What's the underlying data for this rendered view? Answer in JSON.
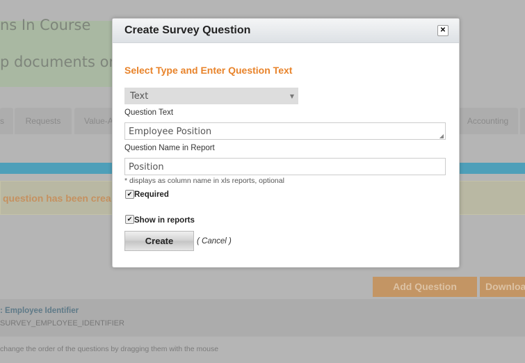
{
  "background": {
    "heading1": "ns In Course",
    "heading2": "p documents or",
    "tabs": [
      "s",
      "Requests",
      "Value-A",
      "Accounting"
    ],
    "message": "question has been crea",
    "add_question": "Add Question",
    "download": "Downloa",
    "item_title": ": Employee Identifier",
    "item_code": "SURVEY_EMPLOYEE_IDENTIFIER",
    "hint": "change the order of the questions by dragging them with the mouse"
  },
  "dialog": {
    "title": "Create Survey Question",
    "close": "✕",
    "section_title": "Select Type and Enter Question Text",
    "type_select": "Text",
    "question_text_label": "Question Text",
    "question_text_value": "Employee Position",
    "report_name_label": "Question Name in Report",
    "report_name_value": "Position",
    "report_name_hint": "* displays as column name in xls reports, optional",
    "required_label": "Required",
    "required_checked": true,
    "show_in_reports_label": "Show in reports",
    "show_in_reports_checked": true,
    "create_button": "Create",
    "cancel_link": "( Cancel )"
  },
  "colors": {
    "accent": "#e8832a",
    "overlay": "#b5b5b5"
  }
}
